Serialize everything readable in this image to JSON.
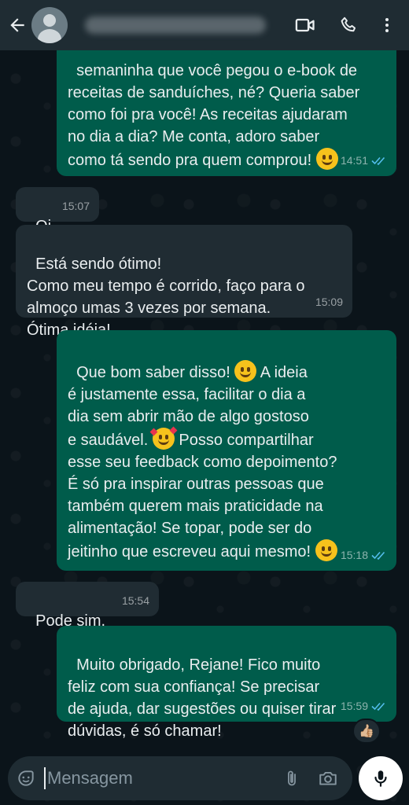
{
  "header": {
    "back_icon": "arrow-left-icon",
    "contact_name": "",
    "video_icon": "video-call-icon",
    "call_icon": "phone-icon",
    "menu_icon": "more-vert-icon"
  },
  "messages": [
    {
      "direction": "out",
      "text": "semaninha que você pegou o e-book de\nreceitas de sanduíches, né? Queria saber\ncomo foi pra você! As receitas ajudaram\nno dia a dia? Me conta, adoro saber\ncomo tá sendo pra quem comprou! ",
      "time": "14:51",
      "read": true
    },
    {
      "direction": "in",
      "text": "Oi",
      "time": "15:07"
    },
    {
      "direction": "in",
      "text": "Está sendo ótimo!\nComo meu tempo é corrido, faço para o\nalmoço umas 3 vezes por semana.\nÓtima idéia!",
      "time": "15:09"
    },
    {
      "direction": "out",
      "text_parts": [
        "Que bom saber disso! ",
        " A ideia\né justamente essa, facilitar o dia a\ndia sem abrir mão de algo gostoso\ne saudável. ",
        " Posso compartilhar\nesse seu feedback como depoimento?\nÉ só pra inspirar outras pessoas que\ntambém querem mais praticidade na\nalimentação! Se topar, pode ser do\njeitinho que escreveu aqui mesmo! "
      ],
      "time": "15:18",
      "read": true
    },
    {
      "direction": "in",
      "text": "Pode sim.",
      "time": "15:54"
    },
    {
      "direction": "out",
      "text": "Muito obrigado, Rejane! Fico muito\nfeliz com sua confiança! Se precisar\nde ajuda, dar sugestões ou quiser tirar\ndúvidas, é só chamar!",
      "time": "15:59",
      "read": true
    }
  ],
  "reaction": {
    "emoji": "👍🏼"
  },
  "composer": {
    "placeholder": "Mensagem",
    "emoji_icon": "sticker-icon",
    "attach_icon": "paperclip-icon",
    "camera_icon": "camera-icon",
    "mic_icon": "microphone-icon"
  },
  "colors": {
    "header": "#1f2c33",
    "outgoing": "#005c4b",
    "incoming": "#202c33",
    "read_ticks": "#53bdeb",
    "background": "#0b141a"
  }
}
